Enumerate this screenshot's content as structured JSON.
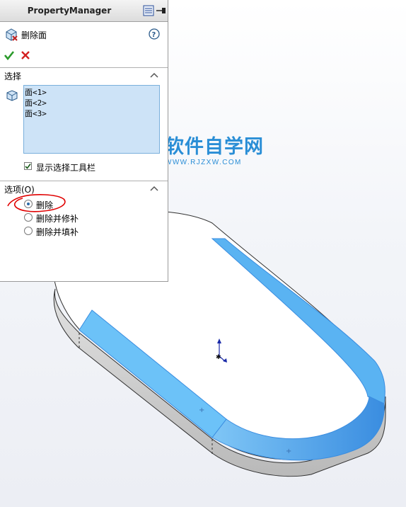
{
  "property_manager": {
    "title": "PropertyManager",
    "feature_name": "删除面",
    "icons": [
      "pin-icon",
      "help-icon",
      "ok-icon",
      "cancel-icon"
    ]
  },
  "selection_section": {
    "title": "选择",
    "items": [
      "面<1>",
      "面<2>",
      "面<3>"
    ],
    "show_toolbar_label": "显示选择工具栏",
    "show_toolbar_checked": true
  },
  "options_section": {
    "title": "选项(O)",
    "options": [
      {
        "label": "删除",
        "selected": true
      },
      {
        "label": "删除并修补",
        "selected": false
      },
      {
        "label": "删除并填补",
        "selected": false
      }
    ]
  },
  "watermark": {
    "cn": "软件自学网",
    "en": "WWW.RJZXW.COM"
  },
  "colors": {
    "selected_face": "#5ab3f2",
    "selection_list_bg": "#cde3f7",
    "ok_green": "#2a9a2a",
    "cancel_red": "#d32020",
    "annotation_red": "#e00000"
  }
}
